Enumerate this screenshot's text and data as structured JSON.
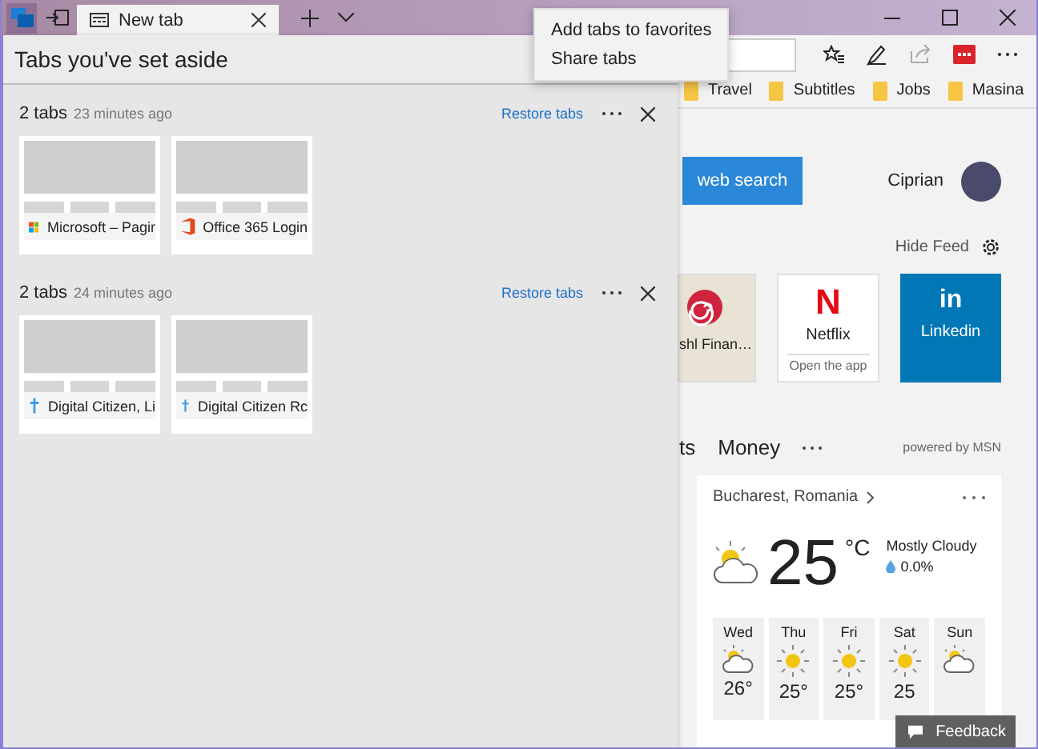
{
  "window": {
    "tabs": [
      {
        "title": "New tab",
        "selected": true
      }
    ]
  },
  "menu": {
    "items": [
      "Add tabs to favorites",
      "Share tabs"
    ]
  },
  "favorites": [
    "Travel",
    "Subtitles",
    "Jobs",
    "Masina"
  ],
  "set_aside": {
    "title": "Tabs you've set aside",
    "groups": [
      {
        "count": "2 tabs",
        "time": "23 minutes ago",
        "restore": "Restore tabs",
        "tabs": [
          {
            "title": "Microsoft – Pagir",
            "kind": "windows"
          },
          {
            "title": "Office 365 Login",
            "kind": "office"
          }
        ]
      },
      {
        "count": "2 tabs",
        "time": "24 minutes ago",
        "restore": "Restore tabs",
        "tabs": [
          {
            "title": "Digital Citizen, Li",
            "kind": "citizen"
          },
          {
            "title": "Digital Citizen Rc",
            "kind": "citizen"
          }
        ]
      }
    ]
  },
  "page": {
    "search_button": "web search",
    "user": "Ciprian",
    "hide_feed": "Hide Feed",
    "tiles": [
      {
        "kind": "spiral",
        "title": "shl Finan…"
      },
      {
        "kind": "netflix",
        "logo": "N",
        "title": "Netflix",
        "subtitle": "Open the app"
      },
      {
        "kind": "linkedin",
        "logo": "in",
        "title": "Linkedin"
      }
    ],
    "feed_tabs": [
      "ts",
      "Money"
    ],
    "powered": "powered by MSN",
    "weather": {
      "location": "Bucharest, Romania",
      "temp": "25",
      "unit": "°C",
      "condition": "Mostly Cloudy",
      "precip": "0.0%",
      "forecast": [
        {
          "day": "Wed",
          "kind": "partly-cloudy",
          "temp": "26°"
        },
        {
          "day": "Thu",
          "kind": "sunny",
          "temp": "25°"
        },
        {
          "day": "Fri",
          "kind": "sunny",
          "temp": "25°"
        },
        {
          "day": "Sat",
          "kind": "sunny",
          "temp": "25"
        },
        {
          "day": "Sun",
          "kind": "partly-cloudy"
        }
      ]
    }
  },
  "feedback": "Feedback"
}
